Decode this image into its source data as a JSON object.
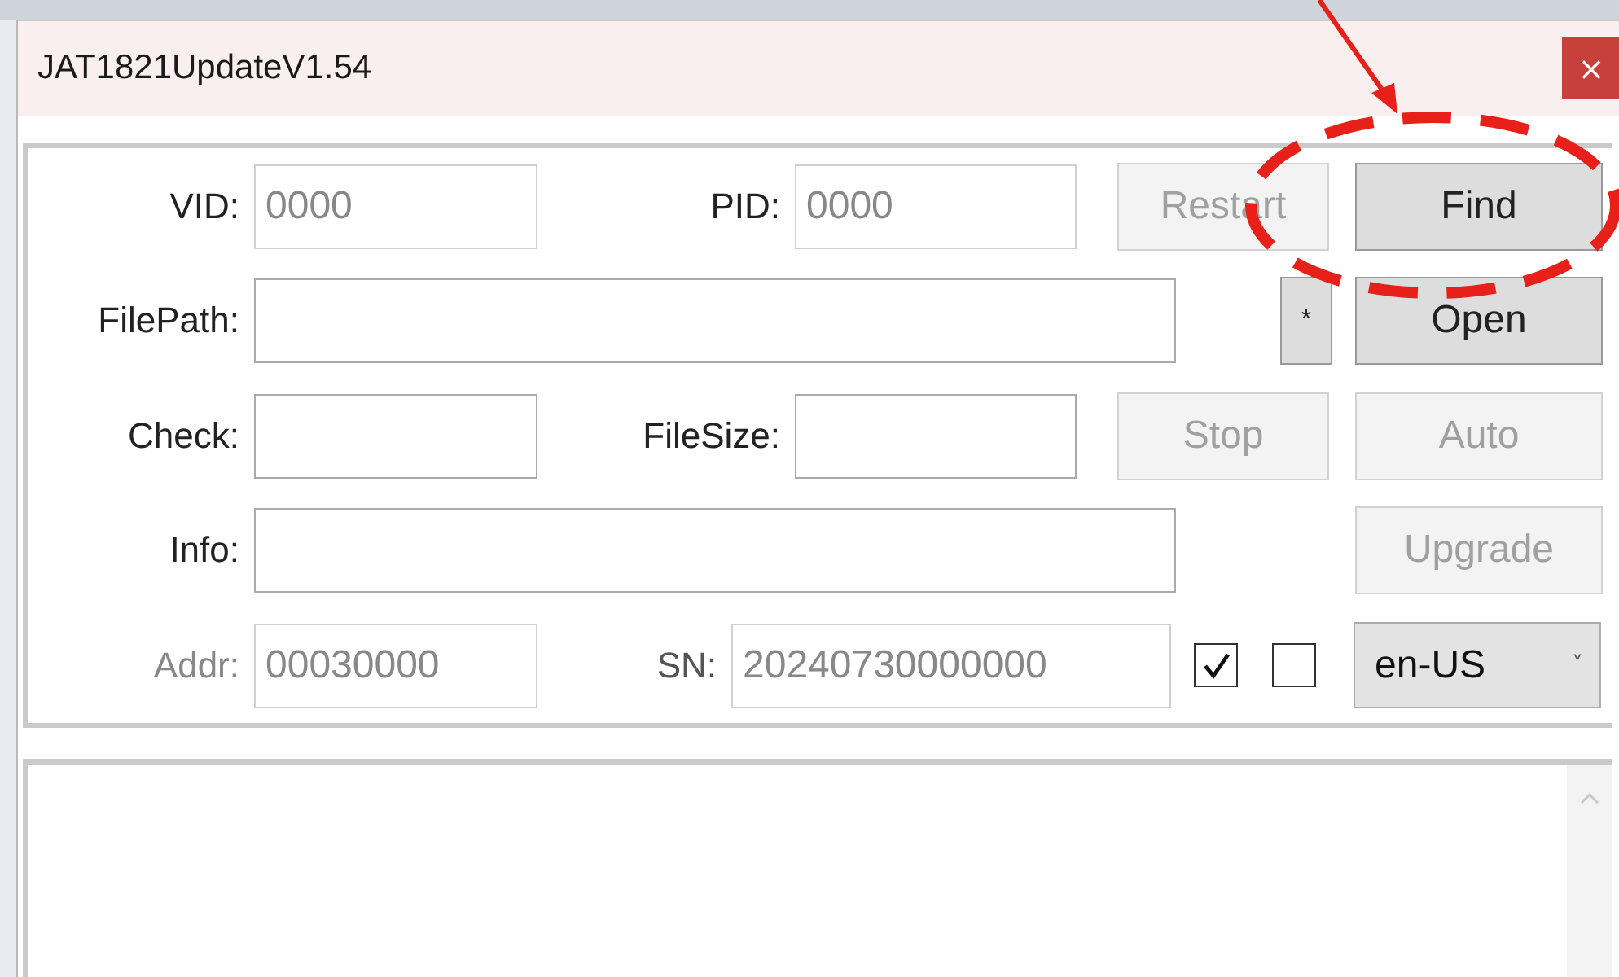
{
  "window": {
    "title": "JAT1821UpdateV1.54",
    "close": "×"
  },
  "vid": {
    "label": "VID:",
    "value": "0000",
    "disabled": true
  },
  "pid": {
    "label": "PID:",
    "value": "0000",
    "disabled": true
  },
  "restart": {
    "label": "Restart",
    "disabled": true
  },
  "find": {
    "label": "Find",
    "disabled": false
  },
  "filepath": {
    "label": "FilePath:"
  },
  "browse": {
    "label": "*",
    "disabled": false
  },
  "open": {
    "label": "Open",
    "disabled": false
  },
  "check": {
    "label": "Check:"
  },
  "filesize": {
    "label": "FileSize:"
  },
  "stop": {
    "label": "Stop",
    "disabled": true
  },
  "auto": {
    "label": "Auto",
    "disabled": true
  },
  "info": {
    "label": "Info:"
  },
  "upgrade": {
    "label": "Upgrade",
    "disabled": true
  },
  "addr": {
    "label": "Addr:",
    "value": "00030000",
    "disabled": true
  },
  "sn": {
    "label": "SN:",
    "value": "20240730000000",
    "disabled": true
  },
  "checkboxes": [
    {
      "checked": true
    },
    {
      "checked": false
    }
  ],
  "language": {
    "value": "en-US",
    "arrow": "˅"
  }
}
